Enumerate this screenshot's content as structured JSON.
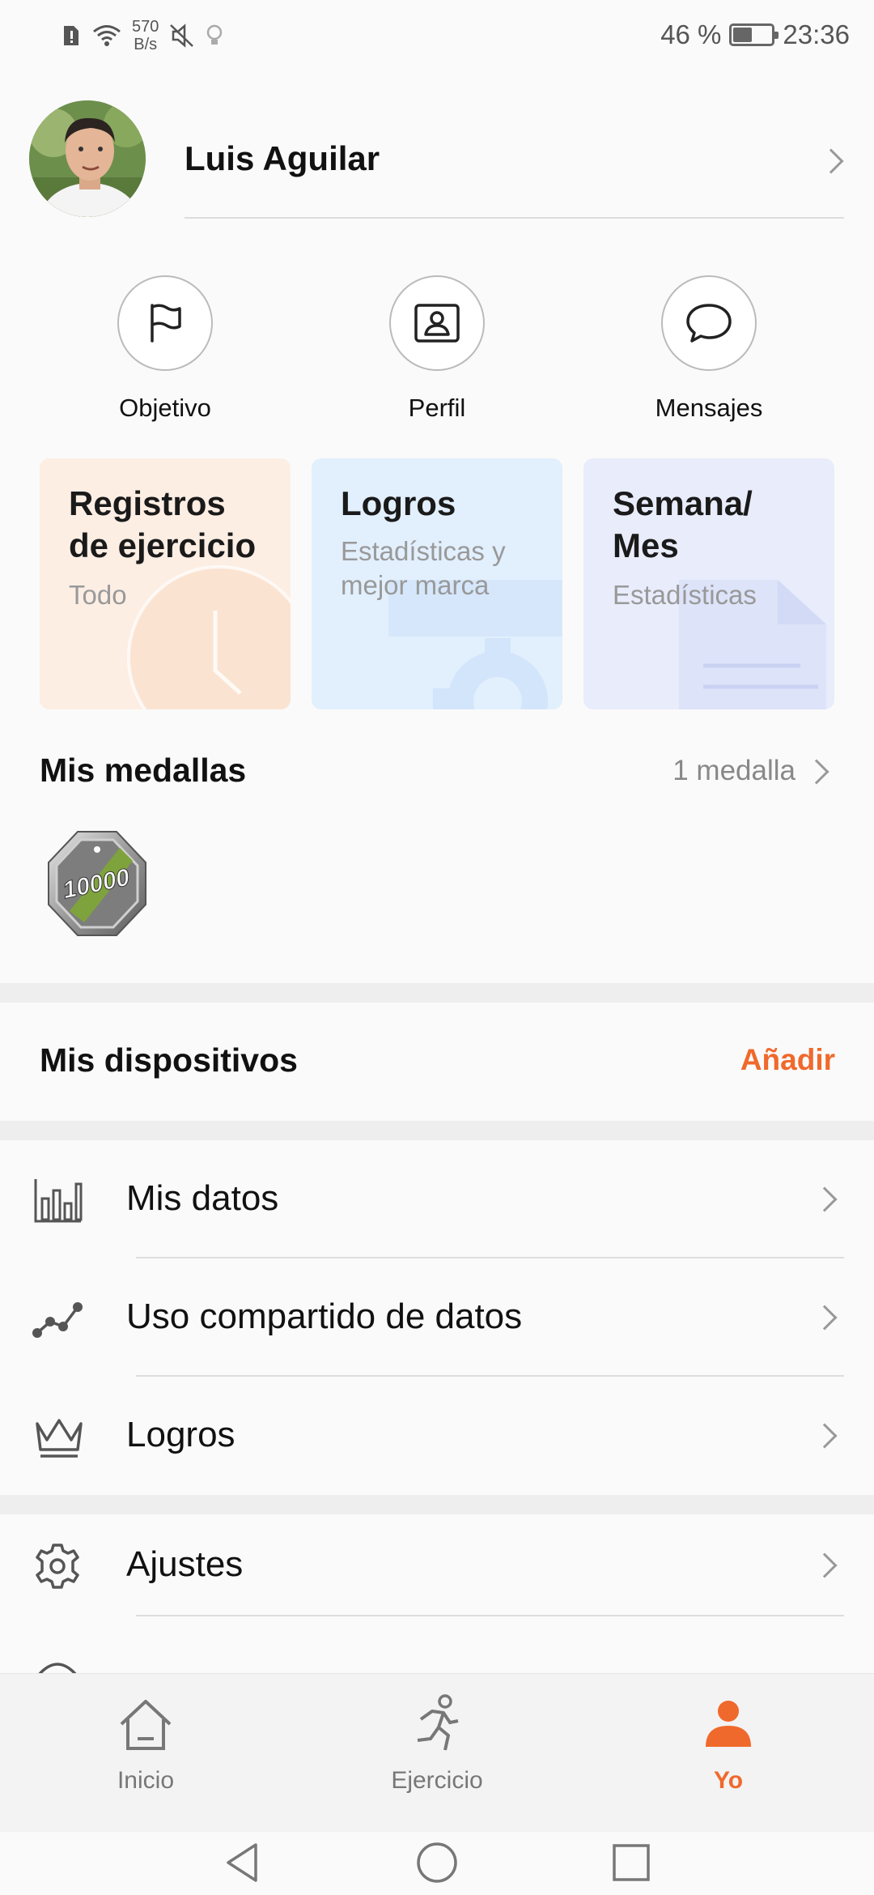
{
  "status_bar": {
    "net_speed_value": "570",
    "net_speed_unit": "B/s",
    "battery_percent_text": "46 %",
    "battery_level": 0.46,
    "time": "23:36"
  },
  "profile": {
    "name": "Luis Aguilar"
  },
  "quick_actions": [
    {
      "label": "Objetivo",
      "icon": "flag-icon"
    },
    {
      "label": "Perfil",
      "icon": "profile-card-icon"
    },
    {
      "label": "Mensajes",
      "icon": "chat-bubble-icon"
    }
  ],
  "cards": [
    {
      "title_line1": "Registros",
      "title_line2": "de ejercicio",
      "subtitle_line1": "Todo",
      "subtitle_line2": "",
      "bg": "#fdeee4"
    },
    {
      "title_line1": "Logros",
      "title_line2": "",
      "subtitle_line1": "Estadísticas y",
      "subtitle_line2": "mejor marca",
      "bg": "#e2effd"
    },
    {
      "title_line1": "Semana/",
      "title_line2": "Mes",
      "subtitle_line1": "Estadísticas",
      "subtitle_line2": "",
      "bg": "#e8ecfb"
    }
  ],
  "medals": {
    "title": "Mis medallas",
    "count_text": "1 medalla",
    "badge_text": "10000"
  },
  "devices": {
    "title": "Mis dispositivos",
    "add_label": "Añadir"
  },
  "menu": [
    {
      "label": "Mis datos",
      "icon": "bar-chart-icon"
    },
    {
      "label": "Uso compartido de datos",
      "icon": "share-graph-icon"
    },
    {
      "label": "Logros",
      "icon": "crown-icon"
    },
    {
      "label": "Ajustes",
      "icon": "gear-icon"
    }
  ],
  "bottom_nav": [
    {
      "label": "Inicio",
      "icon": "home-icon",
      "active": false
    },
    {
      "label": "Ejercicio",
      "icon": "running-icon",
      "active": false
    },
    {
      "label": "Yo",
      "icon": "person-icon",
      "active": true
    }
  ],
  "colors": {
    "accent": "#f0692c",
    "background": "#fafafa",
    "divider": "#dddddd"
  }
}
